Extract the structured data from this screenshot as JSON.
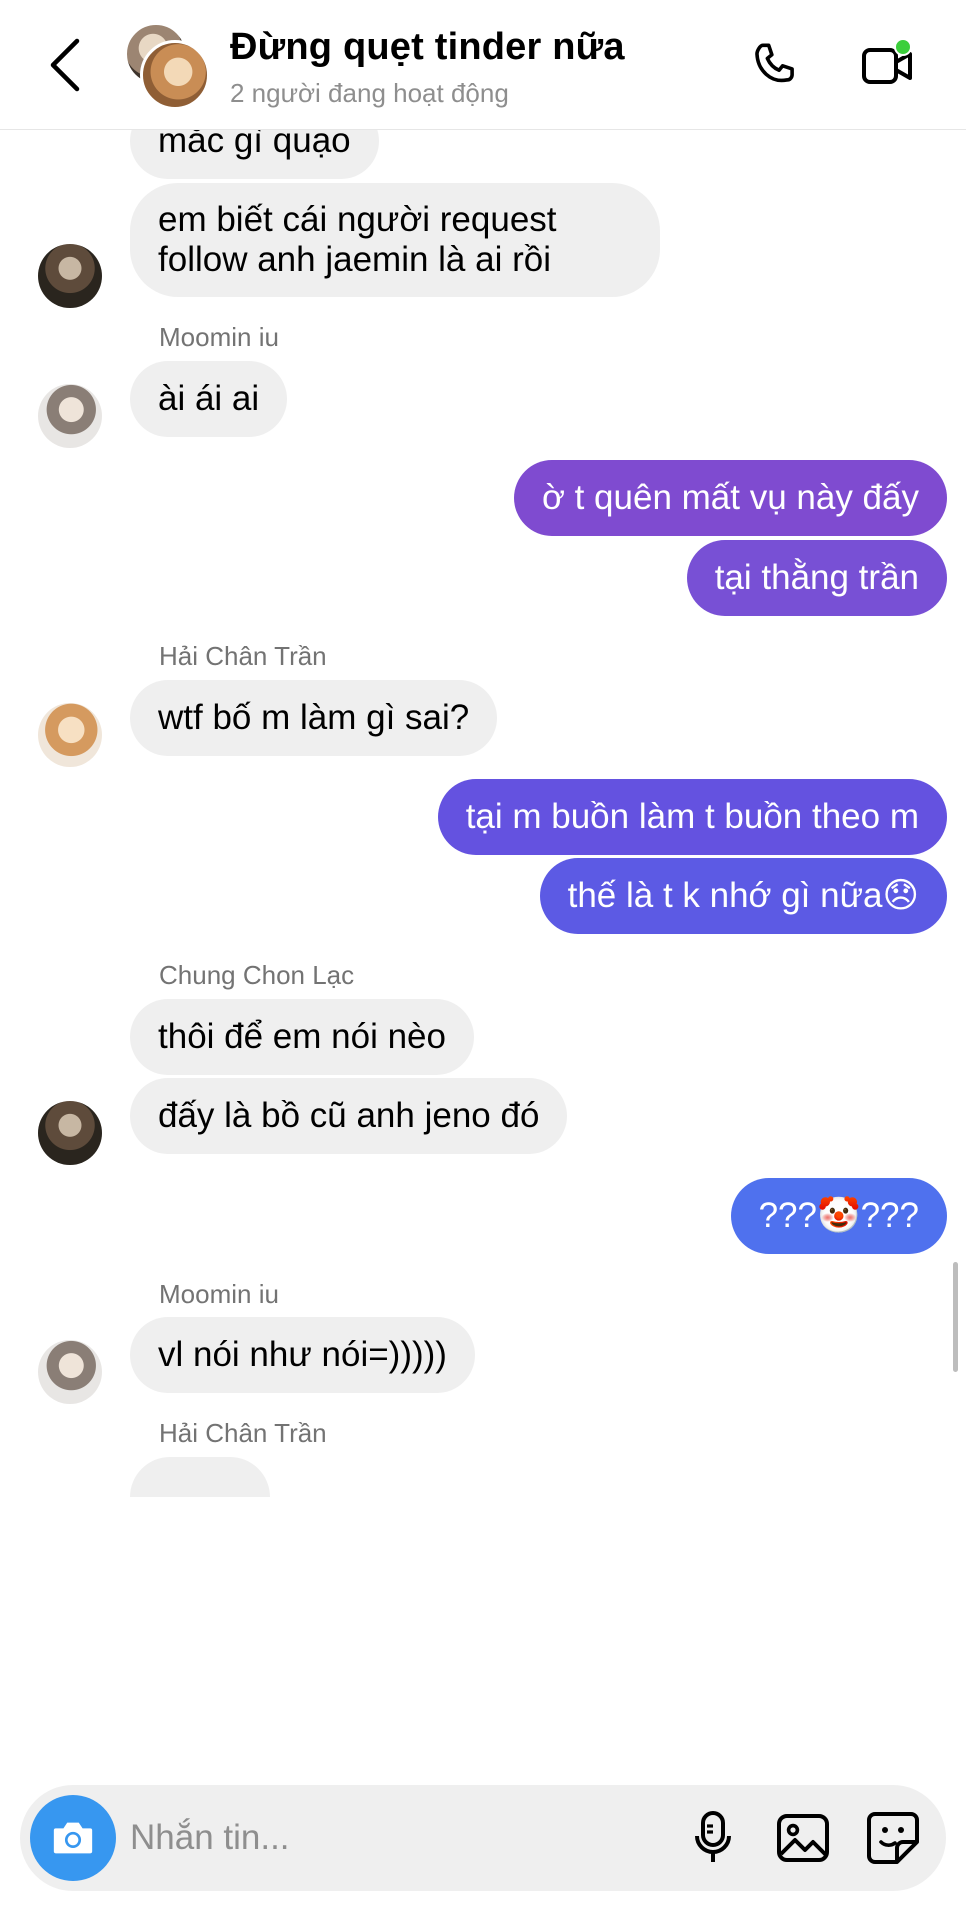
{
  "header": {
    "title": "Đừng quẹt tinder nữa",
    "subtitle": "2 người đang hoạt động"
  },
  "messages": [
    {
      "type": "in",
      "text": "mắc gì quạo"
    },
    {
      "type": "in",
      "text": "em biết cái người request follow anh jaemin là ai rồi"
    },
    {
      "type": "sender",
      "text": "Moomin iu"
    },
    {
      "type": "in",
      "text": "ài ái ai"
    },
    {
      "type": "out",
      "text": "ờ t quên mất vụ này đấy"
    },
    {
      "type": "out",
      "text": "tại thằng trần"
    },
    {
      "type": "sender",
      "text": "Hải Chân Trần"
    },
    {
      "type": "in",
      "text": "wtf bố m làm gì sai?"
    },
    {
      "type": "out",
      "text": "tại m buồn làm t buồn theo m"
    },
    {
      "type": "out",
      "text": "thế là t k nhớ gì nữa",
      "emoji": "😞"
    },
    {
      "type": "sender",
      "text": "Chung Chon Lạc"
    },
    {
      "type": "in",
      "text": "thôi để em nói nèo"
    },
    {
      "type": "in",
      "text": "đấy là bồ cũ anh jeno đó"
    },
    {
      "type": "out",
      "text_before": "???",
      "emoji": "🤡",
      "text_after": "???"
    },
    {
      "type": "sender",
      "text": "Moomin iu"
    },
    {
      "type": "in",
      "text": "vl nói như nói=)))))"
    },
    {
      "type": "sender",
      "text": "Hải Chân Trần"
    }
  ],
  "composer": {
    "placeholder": "Nhắn tin..."
  },
  "colors": {
    "outgoing_purple": "#7f4bd0",
    "outgoing_indigo": "#6452e0",
    "outgoing_blue": "#4f71ee",
    "camera_blue": "#3797f0",
    "online_green": "#3ccf3c"
  },
  "icons": [
    "back-icon",
    "phone-icon",
    "video-icon",
    "camera-icon",
    "microphone-icon",
    "gallery-icon",
    "sticker-icon"
  ]
}
